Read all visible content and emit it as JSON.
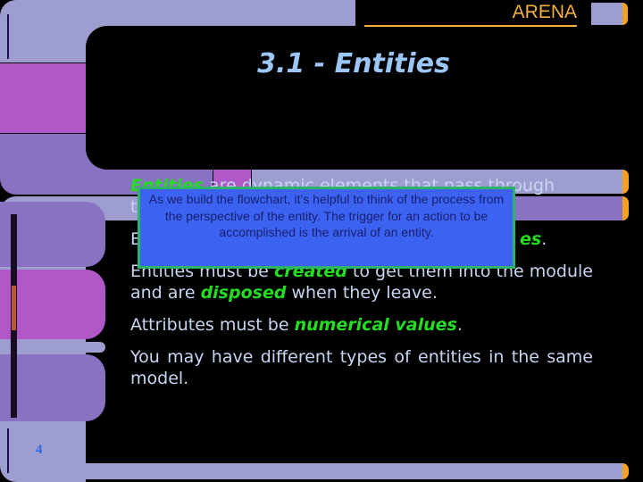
{
  "header": {
    "brand": "ARENA",
    "title": "3.1 - Entities"
  },
  "colors": {
    "lavender": "#9d9dd0",
    "purple": "#8a72c2",
    "magenta": "#b058c8",
    "cap": "#f4a020",
    "text": "#c6d6f0",
    "emphasis": "#22dd22",
    "title": "#9cc6f6",
    "tooltip_bg": "#3b62f0",
    "tooltip_border": "#2eb36a"
  },
  "body": {
    "p1": {
      "em": "Entities",
      "rest": " are dynamic elements that pass through",
      "line2": "t"
    },
    "p2": {
      "start": "E",
      "em": "es",
      "end": "."
    },
    "p3": {
      "a": "Entities must be ",
      "em1": "created",
      "b": " to get them into the module and are ",
      "em2": "disposed",
      "c": " when they leave."
    },
    "p4": {
      "a": "Attributes must be ",
      "em": "numerical values",
      "b": "."
    },
    "p5": "You may have different types of entities in the same model."
  },
  "tooltip": {
    "text": "As we build the flowchart, it’s helpful to think of the process from the perspective of the entity. The trigger for an action to be accomplished is the arrival of an entity."
  },
  "footer": {
    "page_number": "4"
  }
}
